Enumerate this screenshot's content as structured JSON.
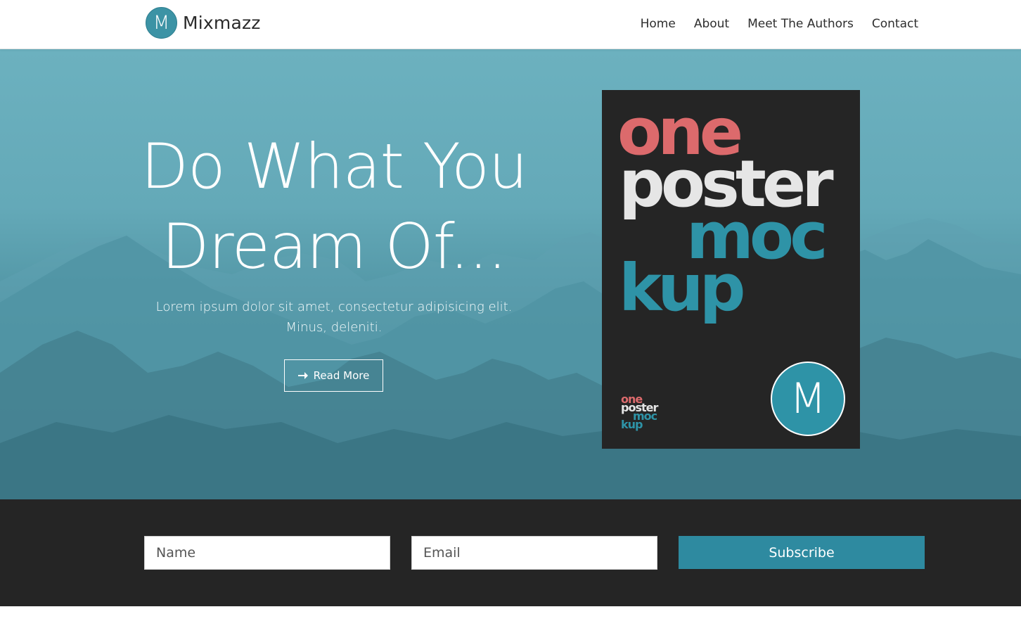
{
  "brand": {
    "logo_letter": "M",
    "name": "Mixmazz"
  },
  "nav": {
    "items": [
      {
        "label": "Home"
      },
      {
        "label": "About"
      },
      {
        "label": "Meet The Authors"
      },
      {
        "label": "Contact"
      }
    ]
  },
  "hero": {
    "title_line1": "Do What You",
    "title_line2": "Dream Of...",
    "text": "Lorem ipsum dolor sit amet, consectetur adipisicing elit. Minus, deleniti.",
    "button_label": "Read More",
    "button_icon": "arrow-right-icon",
    "background_color": "#64a9b8"
  },
  "poster": {
    "line1": "one",
    "line2": "poster",
    "line3": "moc",
    "line4": "kup",
    "small_line1": "one",
    "small_line2": "poster",
    "small_line3": "moc",
    "small_line4": "kup",
    "logo_letter": "M",
    "colors": {
      "one": "#dc6a6c",
      "poster": "#e6e6e6",
      "mockup": "#2e93a7",
      "background": "#252525"
    }
  },
  "subscribe": {
    "name_placeholder": "Name",
    "email_placeholder": "Email",
    "button_label": "Subscribe",
    "button_color": "#2e8aa0",
    "bar_color": "#252525"
  }
}
